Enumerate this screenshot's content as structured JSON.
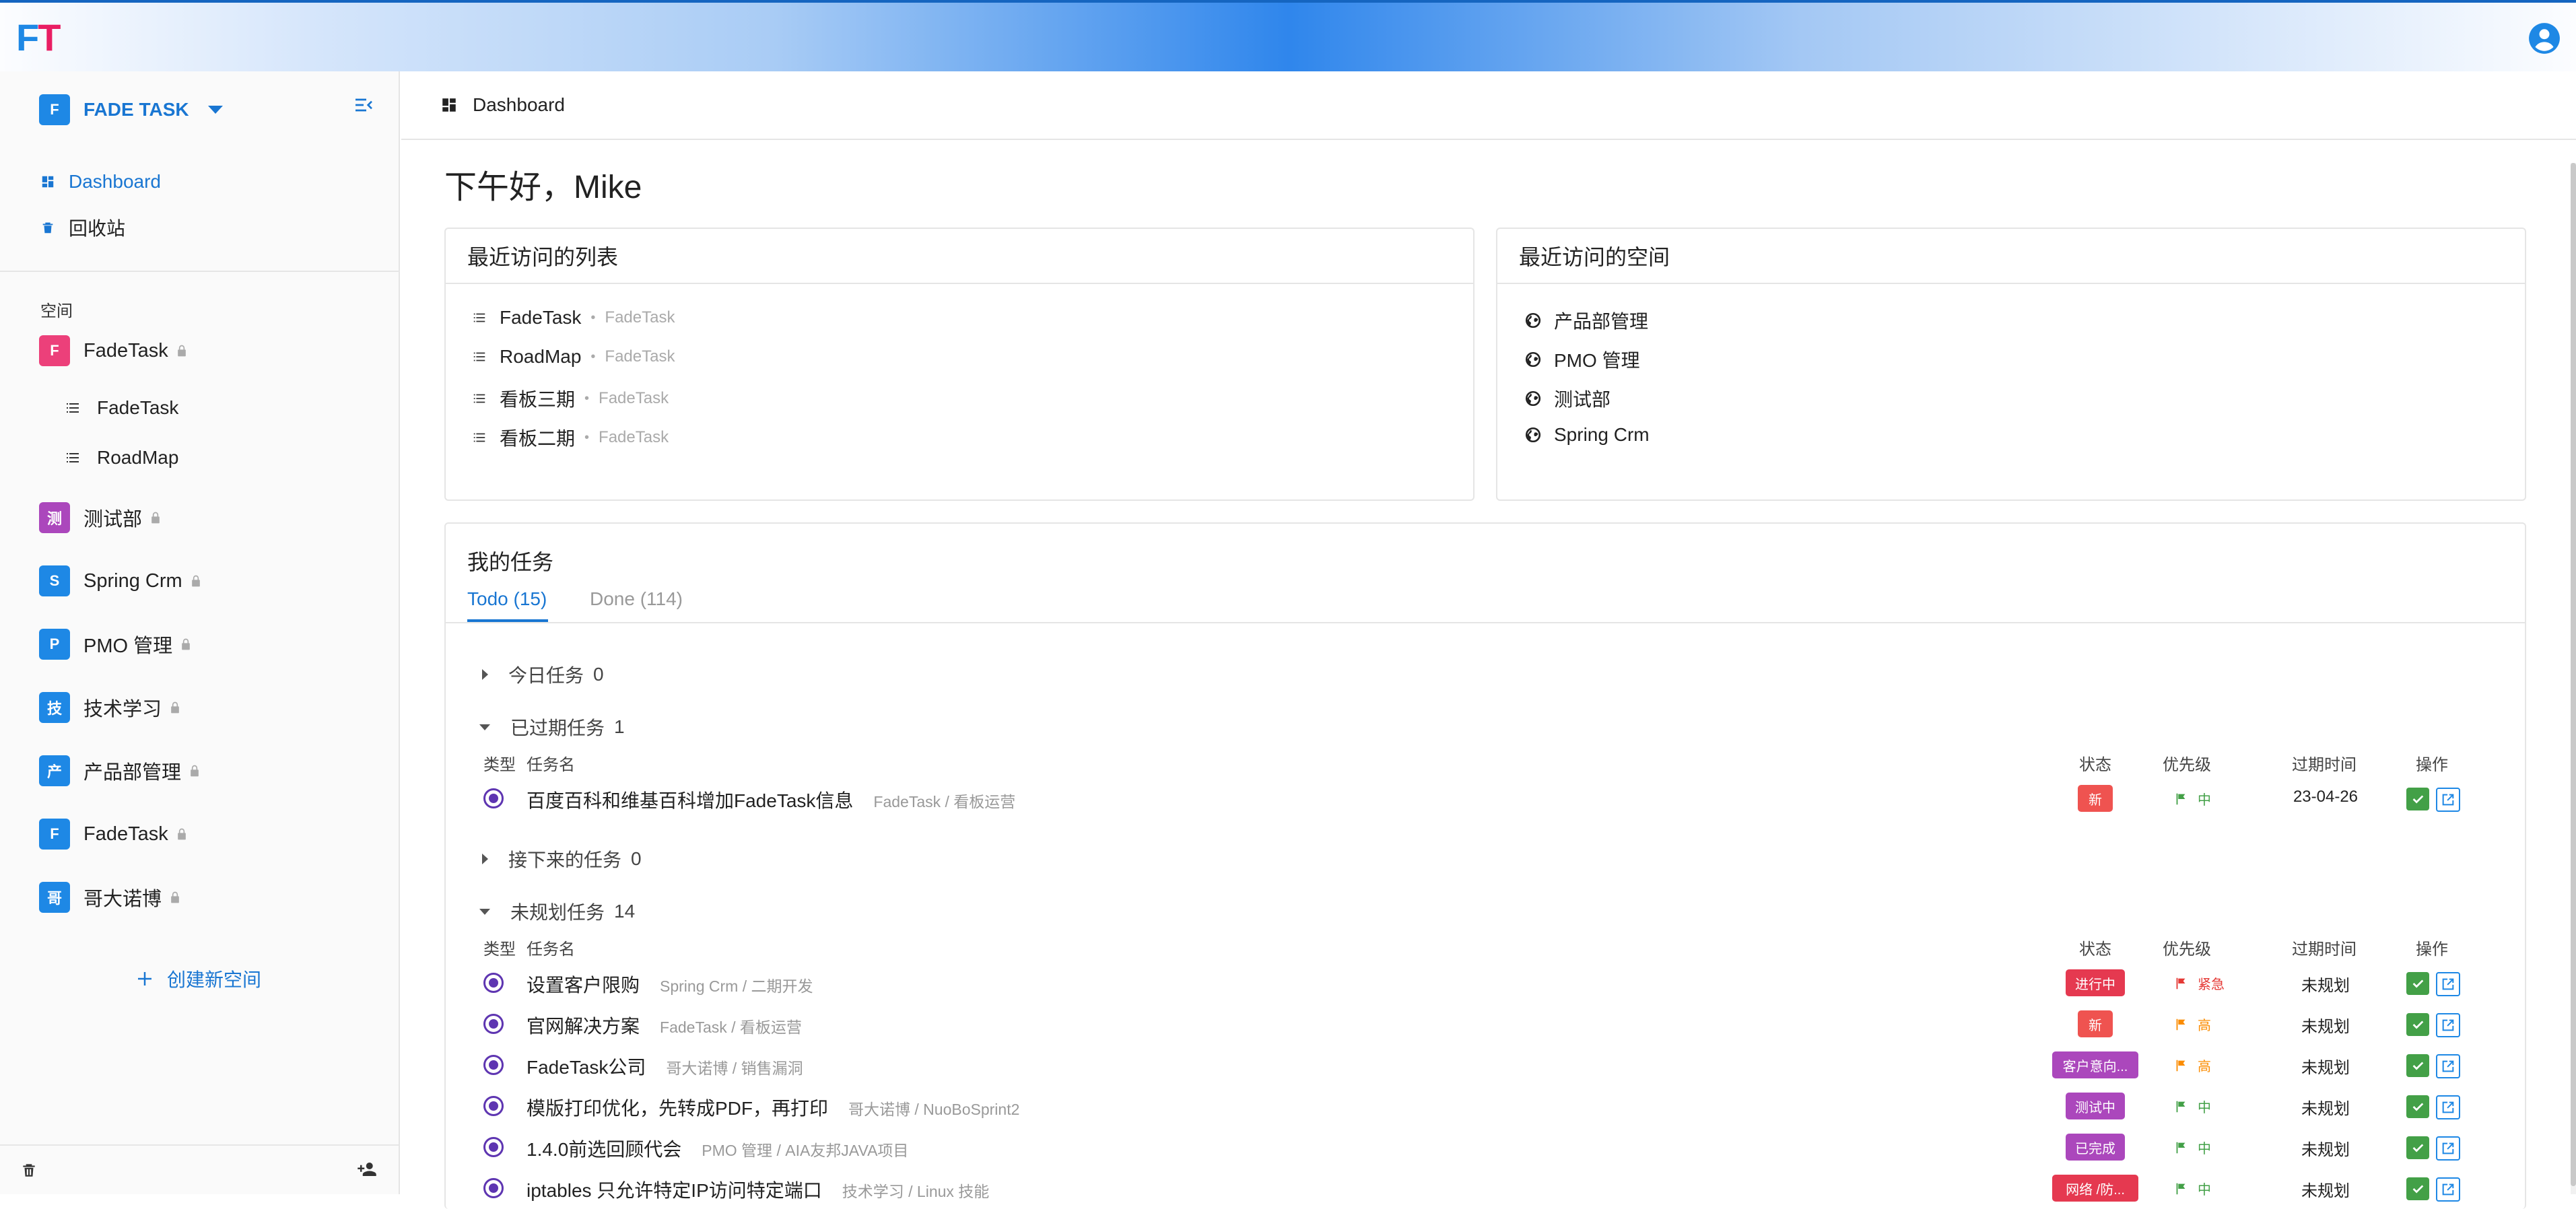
{
  "app": {
    "logo_f": "F",
    "logo_t": "T"
  },
  "workspace": {
    "initial": "F",
    "name": "FADE TASK",
    "color": "#1e88e5"
  },
  "nav": [
    {
      "label": "Dashboard",
      "active": true
    },
    {
      "label": "回收站",
      "active": false
    }
  ],
  "spaces_label": "空间",
  "spaces": [
    {
      "initial": "F",
      "name": "FadeTask",
      "color": "#ec407a"
    },
    {
      "initial": "测",
      "name": "测试部",
      "color": "#ab47bc"
    },
    {
      "initial": "S",
      "name": "Spring Crm",
      "color": "#1e88e5"
    },
    {
      "initial": "P",
      "name": "PMO 管理",
      "color": "#1e88e5"
    },
    {
      "initial": "技",
      "name": "技术学习",
      "color": "#1e88e5"
    },
    {
      "initial": "产",
      "name": "产品部管理",
      "color": "#1e88e5"
    },
    {
      "initial": "F",
      "name": "FadeTask",
      "color": "#1e88e5"
    },
    {
      "initial": "哥",
      "name": "哥大诺博",
      "color": "#1e88e5"
    }
  ],
  "subitems": [
    "FadeTask",
    "RoadMap"
  ],
  "create_space": "创建新空间",
  "header": {
    "title": "Dashboard"
  },
  "greeting": "下午好，Mike",
  "recent_lists": {
    "title": "最近访问的列表",
    "items": [
      {
        "name": "FadeTask",
        "source": "FadeTask"
      },
      {
        "name": "RoadMap",
        "source": "FadeTask"
      },
      {
        "name": "看板三期",
        "source": "FadeTask"
      },
      {
        "name": "看板二期",
        "source": "FadeTask"
      }
    ]
  },
  "recent_spaces": {
    "title": "最近访问的空间",
    "items": [
      "产品部管理",
      "PMO 管理",
      "测试部",
      "Spring Crm"
    ]
  },
  "my_tasks": {
    "title": "我的任务",
    "tabs": [
      "Todo (15)",
      "Done (114)"
    ],
    "columns": {
      "type": "类型",
      "name": "任务名",
      "status": "状态",
      "priority": "优先级",
      "due": "过期时间",
      "actions": "操作"
    },
    "groups": [
      {
        "name": "今日任务",
        "count": "0"
      },
      {
        "name": "已过期任务",
        "count": "1"
      },
      {
        "name": "接下来的任务",
        "count": "0"
      },
      {
        "name": "未规划任务",
        "count": "14"
      }
    ],
    "overdue": [
      {
        "name": "百度百科和维基百科增加FadeTask信息",
        "path": "FadeTask / 看板运营",
        "status": "新",
        "status_color": "#ef5350",
        "priority": "中",
        "priority_color": "#43a047",
        "due": "23-04-26"
      }
    ],
    "unplanned": [
      {
        "name": "设置客户限购",
        "path": "Spring Crm / 二期开发",
        "status": "进行中",
        "status_color": "#e53950",
        "priority": "紧急",
        "priority_color": "#e53935",
        "due": "未规划"
      },
      {
        "name": "官网解决方案",
        "path": "FadeTask / 看板运营",
        "status": "新",
        "status_color": "#ef5350",
        "priority": "高",
        "priority_color": "#fb8c00",
        "due": "未规划"
      },
      {
        "name": "FadeTask公司",
        "path": "哥大诺博 / 销售漏洞",
        "status": "客户意向...",
        "status_color": "#ab47bc",
        "priority": "高",
        "priority_color": "#fb8c00",
        "due": "未规划"
      },
      {
        "name": "模版打印优化，先转成PDF，再打印",
        "path": "哥大诺博 / NuoBoSprint2",
        "status": "测试中",
        "status_color": "#ab47bc",
        "priority": "中",
        "priority_color": "#43a047",
        "due": "未规划"
      },
      {
        "name": "1.4.0前选回顾代会",
        "path": "PMO 管理 / AIA友邦JAVA项目",
        "status": "已完成",
        "status_color": "#ab47bc",
        "priority": "中",
        "priority_color": "#43a047",
        "due": "未规划"
      },
      {
        "name": "iptables 只允许特定IP访问特定端口",
        "path": "技术学习 / Linux 技能",
        "status": "网络 /防...",
        "status_color": "#e53950",
        "priority": "中",
        "priority_color": "#43a047",
        "due": "未规划"
      }
    ]
  }
}
